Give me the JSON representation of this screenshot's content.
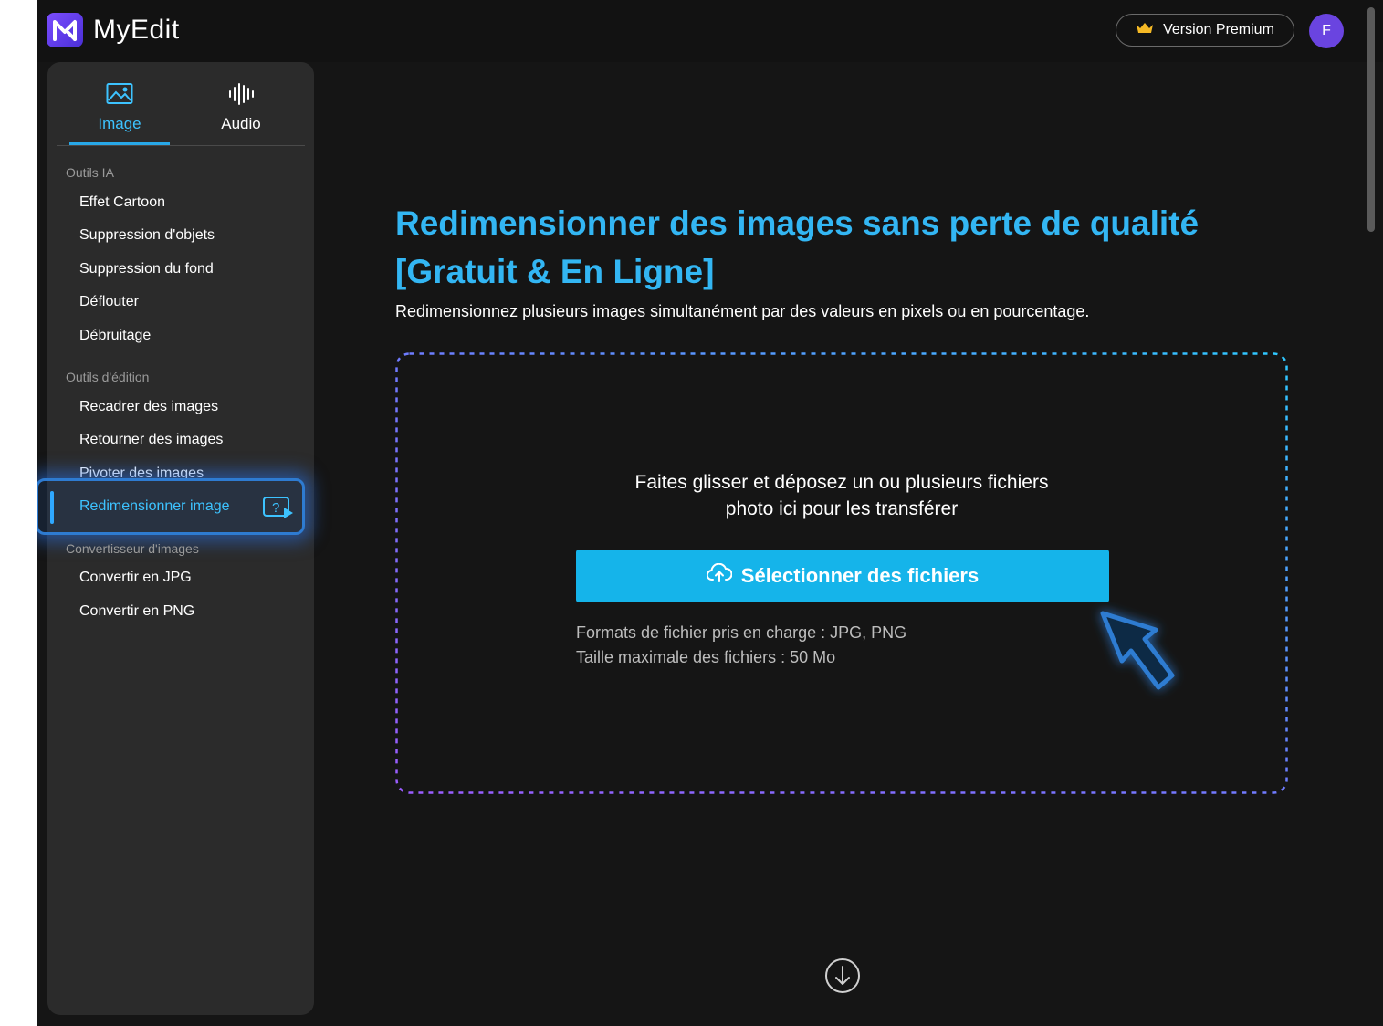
{
  "header": {
    "brand": "MyEdit",
    "premium_label": "Version Premium",
    "avatar_initial": "F"
  },
  "sidebar": {
    "tabs": [
      {
        "label": "Image",
        "icon": "image-icon",
        "active": true
      },
      {
        "label": "Audio",
        "icon": "audio-wave-icon",
        "active": false
      }
    ],
    "sections": [
      {
        "title": "Outils IA",
        "items": [
          "Effet Cartoon",
          "Suppression d'objets",
          "Suppression du fond",
          "Déflouter",
          "Débruitage"
        ]
      },
      {
        "title": "Outils d'édition",
        "items": [
          "Recadrer des images",
          "Retourner des images",
          "Pivoter des images",
          "Redimensionner image"
        ]
      },
      {
        "title": "Convertisseur d'images",
        "items": [
          "Convertir en JPG",
          "Convertir en PNG"
        ]
      }
    ],
    "active_item": "Redimensionner image"
  },
  "main": {
    "headline_line1": "Redimensionner des images sans perte de qualité",
    "headline_line2": "[Gratuit & En Ligne]",
    "subtitle": "Redimensionnez plusieurs images simultanément par des valeurs en pixels ou en pourcentage.",
    "dropzone": {
      "text_line1": "Faites glisser et déposez un ou plusieurs fichiers",
      "text_line2": "photo ici pour les transférer",
      "button_label": "Sélectionner des fichiers",
      "formats": "Formats de fichier pris en charge : JPG, PNG",
      "max_size": "Taille maximale des fichiers : 50 Mo"
    }
  },
  "colors": {
    "accent": "#33b6f3",
    "button": "#15b4ea",
    "highlight": "#2e7bd1",
    "avatar": "#6a44e0",
    "background": "#151515",
    "sidebar": "#2b2b2b"
  }
}
